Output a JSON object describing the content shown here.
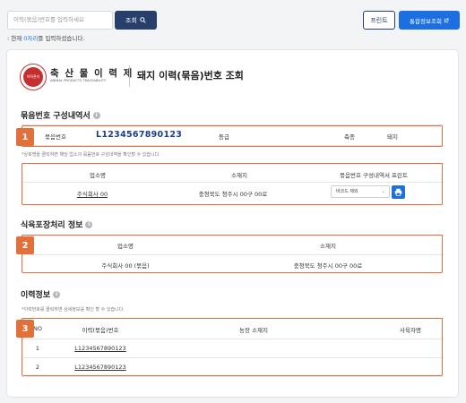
{
  "topbar": {
    "search_placeholder": "이력(묶음)번호를 입력하세요",
    "search_label": "조회",
    "print_label": "프린트",
    "integrated_label": "통합정보조회",
    "hint_prefix": ": 현재 ",
    "hint_count": "0자리",
    "hint_suffix": "를 입력하셨습니다."
  },
  "brand": {
    "name_ko": "축 산 물 이 력 제",
    "name_en": "ANIMAL PRODUCTS TRACEABILITY",
    "logo_text": "이력관리"
  },
  "page_title": "돼지 이력(묶음)번호 조회",
  "bundle": {
    "title": "묶음번호 구성내역서",
    "badge": "1",
    "number_label": "묶음번호",
    "number_value": "L1234567890123",
    "grade_label": "등급",
    "grade_value": "",
    "species_label": "축종",
    "species_value": "돼지",
    "note": "*상호명을 클릭하면 해당 업소의 묶음번호 구성내역을 확인할 수 있습니다.",
    "columns": [
      "업소명",
      "소재지",
      "묶음번호 구성내역서 프린트"
    ],
    "row": {
      "company": "주식회사 00",
      "address": "충청북도 청주시 00구 00로"
    },
    "select_value": "바코드 제외"
  },
  "packing": {
    "title": "식육포장처리 정보",
    "badge": "2",
    "columns": [
      "업소명",
      "소재지"
    ],
    "row": {
      "company": "주식회사 00 (묶음)",
      "address": "충청북도 청주시 00구 00로"
    }
  },
  "history": {
    "title": "이력정보",
    "badge": "3",
    "note": "*이력번호를 클릭하면 상세정보를 확인 할 수 있습니다.",
    "columns": [
      "NO",
      "이력(묶음)번호",
      "농장 소재지",
      "사육자명"
    ],
    "rows": [
      {
        "no": "1",
        "number": "L1234567890123",
        "farm": "",
        "owner": ""
      },
      {
        "no": "2",
        "number": "L1234567890123",
        "farm": "",
        "owner": ""
      }
    ]
  },
  "colors": {
    "primary": "#283e6b",
    "accent": "#1c6fe0",
    "highlight": "#e2703a",
    "brand_red": "#c62f2f"
  }
}
